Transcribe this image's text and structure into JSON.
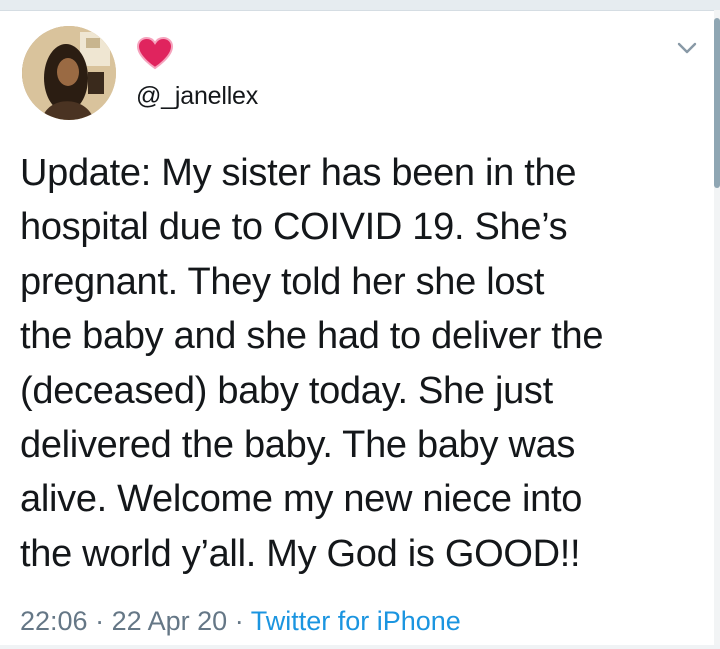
{
  "tweet": {
    "handle": "@_janellex",
    "text_lines": [
      "Update: My sister has been in the",
      "hospital due to COIVID 19. She’s",
      "pregnant. They told her she lost",
      "the baby and she had to deliver the",
      "(deceased) baby today. She just",
      "delivered the baby. The baby was",
      "alive. Welcome my new niece into",
      "the world y’all. My God is GOOD!!"
    ],
    "time": "22:06",
    "date": "22 Apr 20",
    "separator": "·",
    "source": "Twitter for iPhone"
  },
  "icons": {
    "name_badge": "heart-icon",
    "menu": "chevron-down-icon",
    "avatar": "avatar"
  },
  "colors": {
    "text": "#14171a",
    "muted": "#657786",
    "link": "#1b95e0",
    "heart": "#e0245e"
  }
}
